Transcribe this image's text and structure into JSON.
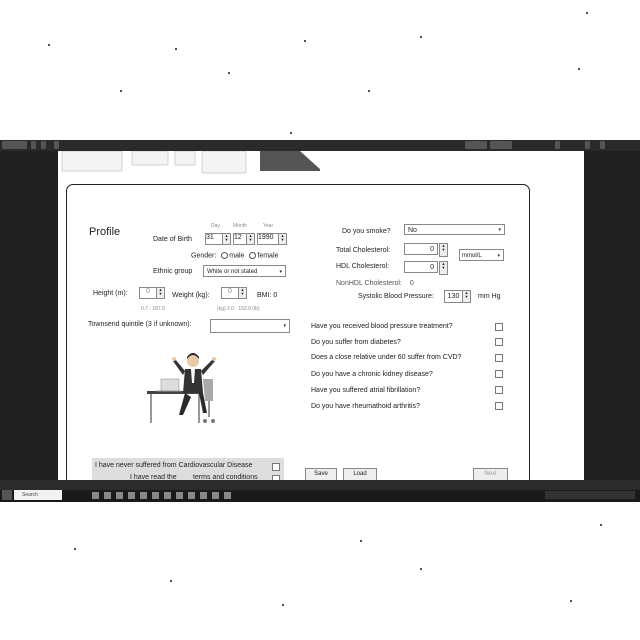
{
  "profile": {
    "title": "Profile",
    "dob_label": "Date of Birth",
    "day_label": "Day",
    "month_label": "Month",
    "year_label": "Year",
    "day": "31",
    "month": "12",
    "year": "1990",
    "gender_label": "Gender:",
    "gender_male": "male",
    "gender_female": "female",
    "ethnic_label": "Ethnic group",
    "ethnic_value": "White or not stated",
    "height_label": "Height (m):",
    "height_value": "0",
    "height_range": "0.7 - 187.0",
    "weight_label": "Weight (kg):",
    "weight_value": "0",
    "weight_range": "(kg) 2.0 - 152.0 (lb)",
    "bmi_label": "BMI: 0",
    "townsend_label": "Townsend quintile (3 if unknown):",
    "townsend_value": ""
  },
  "health": {
    "smoke_label": "Do you smoke?",
    "smoke_value": "No",
    "total_chol_label": "Total Cholesterol:",
    "total_chol_value": "0",
    "chol_unit": "mmol/L",
    "hdl_label": "HDL Cholesterol:",
    "hdl_value": "0",
    "nonhdl_label": "NonHDL Cholesterol:",
    "nonhdl_value": "0",
    "sbp_label": "Systolic Blood Pressure:",
    "sbp_value": "130",
    "sbp_unit": "mm Hg"
  },
  "questions": [
    "Have you received blood pressure treatment?",
    "Do you suffer from diabetes?",
    "Does a close relative under 60 suffer from CVD?",
    "Do you have a chronic kidney disease?",
    "Have you suffered atrial fibrillation?",
    "Do you have rheumathoid arthritis?"
  ],
  "footer": {
    "never_suffered": "I have never suffered from Cardiovascular Disease",
    "terms_prefix": "I have read the",
    "terms_link": "terms and conditions",
    "save": "Save",
    "load": "Load",
    "next": "Next"
  },
  "taskbar": {
    "search": "Search"
  }
}
